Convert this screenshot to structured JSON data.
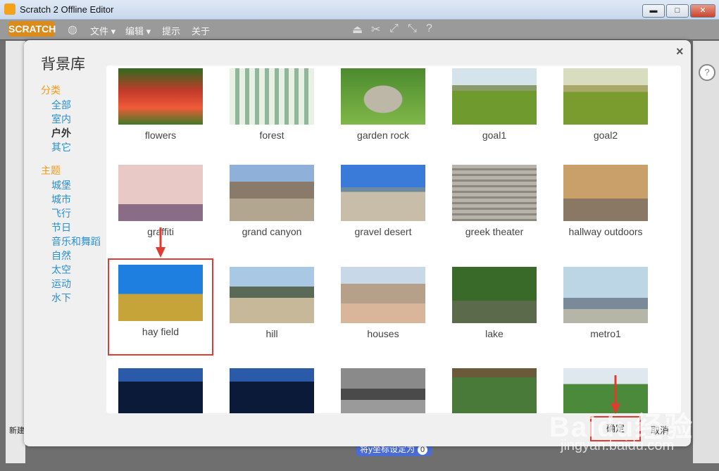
{
  "window": {
    "title": "Scratch 2 Offline Editor",
    "min_glyph": "▬",
    "max_glyph": "□",
    "close_glyph": "✕"
  },
  "menubar": {
    "logo_text": "SCRATCH",
    "globe_icon": "globe-icon",
    "items": [
      "文件 ▾",
      "编辑 ▾",
      "提示",
      "关于"
    ],
    "tool_icons": [
      "stamp-icon",
      "scissors-icon",
      "grow-icon",
      "shrink-icon",
      "help-icon"
    ]
  },
  "dialog": {
    "title": "背景库",
    "close_glyph": "×",
    "ok_label": "确定",
    "cancel_label": "取消"
  },
  "sidebar": {
    "category_heading": "分类",
    "categories": [
      "全部",
      "室内",
      "户外",
      "其它"
    ],
    "active_category": "户外",
    "theme_heading": "主题",
    "themes": [
      "城堡",
      "城市",
      "飞行",
      "节日",
      "音乐和舞蹈",
      "自然",
      "太空",
      "运动",
      "水下"
    ]
  },
  "backdrops": [
    {
      "label": "flowers"
    },
    {
      "label": "forest"
    },
    {
      "label": "garden rock"
    },
    {
      "label": "goal1"
    },
    {
      "label": "goal2"
    },
    {
      "label": "graffiti"
    },
    {
      "label": "grand canyon"
    },
    {
      "label": "gravel desert"
    },
    {
      "label": "greek theater"
    },
    {
      "label": "hallway outdoors"
    },
    {
      "label": "hay field"
    },
    {
      "label": "hill"
    },
    {
      "label": "houses"
    },
    {
      "label": "lake"
    },
    {
      "label": "metro1"
    },
    {
      "label": ""
    },
    {
      "label": ""
    },
    {
      "label": ""
    },
    {
      "label": ""
    },
    {
      "label": ""
    }
  ],
  "selected_backdrop": "hay field",
  "background_app": {
    "help_glyph": "?",
    "block_text": "将y坐标设定为",
    "block_value": "0",
    "left_text": "新建"
  },
  "watermark": {
    "text": "Baidu经验",
    "url": "jingyan.baidu.com"
  }
}
